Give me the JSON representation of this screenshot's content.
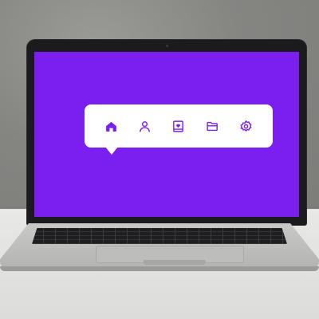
{
  "menu": {
    "items": [
      {
        "name": "home",
        "icon": "home-icon",
        "active": true
      },
      {
        "name": "profile",
        "icon": "user-icon",
        "active": false
      },
      {
        "name": "favorites",
        "icon": "heart-book-icon",
        "active": false
      },
      {
        "name": "folder",
        "icon": "folder-icon",
        "active": false
      },
      {
        "name": "settings",
        "icon": "gear-icon",
        "active": false
      }
    ]
  },
  "colors": {
    "screen_background": "#7a1ff0",
    "menu_background": "#ffffff",
    "icon_color": "#7a1ff0"
  }
}
